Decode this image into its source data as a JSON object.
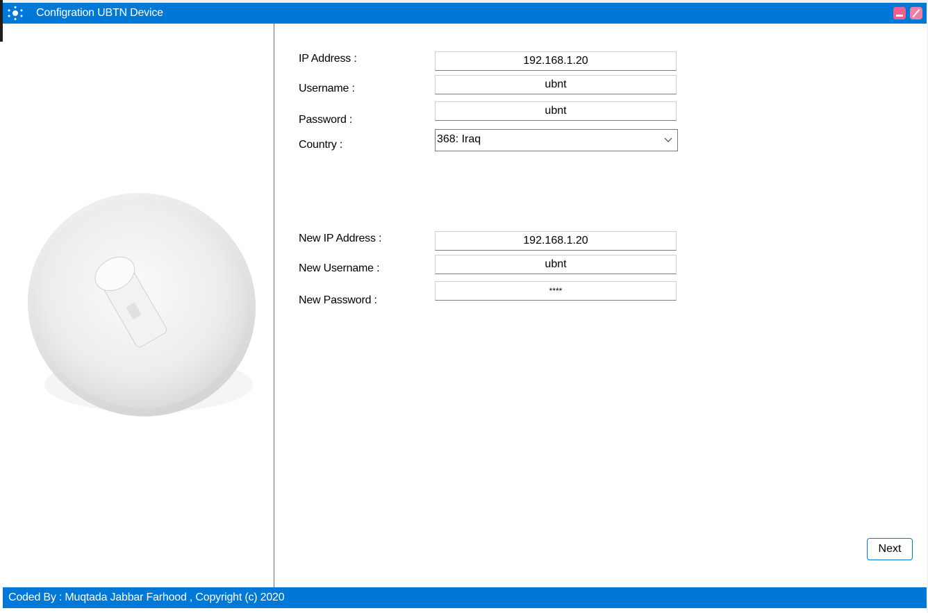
{
  "window": {
    "title": "Configration UBTN Device",
    "icon": "ubnt-logo-icon"
  },
  "current": {
    "ip_label": "IP Address :",
    "ip_value": "192.168.1.20",
    "username_label": "Username :",
    "username_value": "ubnt",
    "password_label": "Password :",
    "password_value": "ubnt",
    "country_label": "Country :",
    "country_value": "368: Iraq"
  },
  "new": {
    "ip_label": "New IP Address :",
    "ip_value": "192.168.1.20",
    "username_label": "New Username :",
    "username_value": "ubnt",
    "password_label": "New Password :",
    "password_value": "****"
  },
  "buttons": {
    "next": "Next"
  },
  "footer": {
    "text": "Coded By : Muqtada Jabbar Farhood  , Copyright (c) 2020"
  },
  "colors": {
    "accent": "#0078d7",
    "window_button": "#f0608a"
  }
}
